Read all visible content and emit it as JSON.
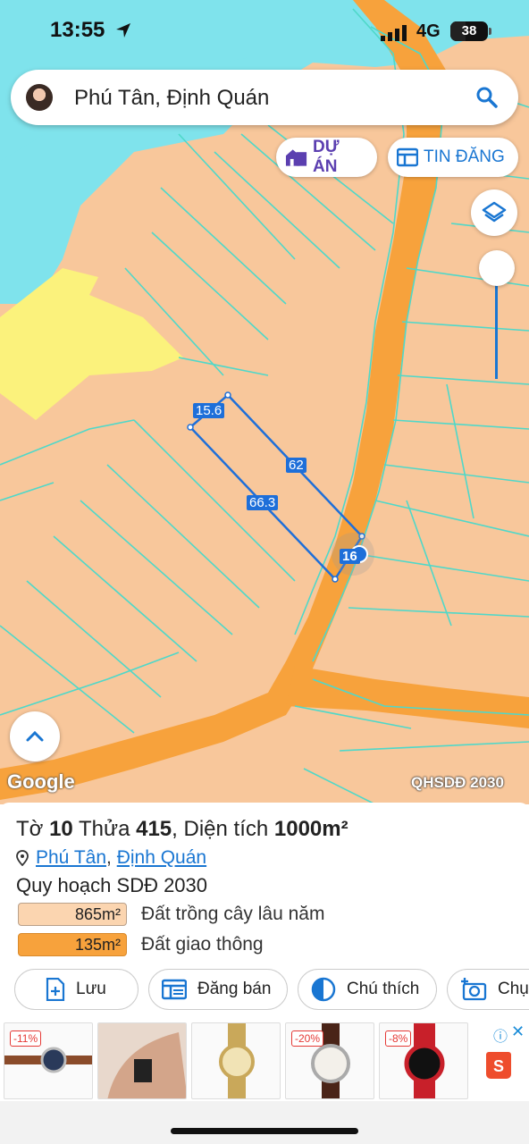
{
  "status": {
    "time": "13:55",
    "network": "4G",
    "battery": "38"
  },
  "search": {
    "text": "Phú Tân, Định Quán"
  },
  "chips": {
    "du_an": "DỰ ÁN",
    "tin_dang": "TIN ĐĂNG"
  },
  "map": {
    "dim_top": "15.6",
    "dim_right": "62",
    "dim_left": "66.3",
    "marker": "16",
    "google": "Google",
    "layer_name": "QHSDĐ 2030",
    "colors": {
      "land": "#f8c79b",
      "road": "#f7a23c",
      "water": "#7fe3ec",
      "yellow": "#fbf27c",
      "parcel": "#4fd8c9",
      "selection": "#1e6fd9"
    }
  },
  "panel": {
    "title_prefix": "Tờ ",
    "sheet_no": "10",
    "title_mid": " Thửa ",
    "parcel_no": "415",
    "title_mid2": ", Diện tích ",
    "area": "1000m²",
    "ward": "Phú Tân",
    "sep": ",",
    "district": "Định Quán",
    "plan_label": "Quy hoạch SDĐ 2030",
    "legend": [
      {
        "area": "865m²",
        "label": "Đất trồng cây lâu năm",
        "color": "#fbd5b0"
      },
      {
        "area": "135m²",
        "label": "Đất giao thông",
        "color": "#f7a23c"
      }
    ],
    "actions": {
      "save": "Lưu",
      "sell": "Đăng bán",
      "legend": "Chú thích",
      "capture": "Chụp"
    }
  },
  "ads": {
    "discounts": [
      "-11%",
      "-20%",
      "-8%"
    ],
    "close": "✕",
    "info": "ⓘ"
  }
}
